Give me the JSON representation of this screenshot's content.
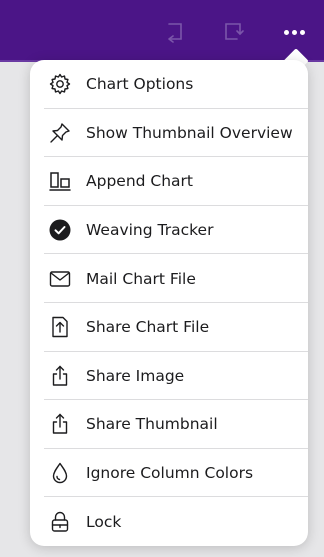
{
  "toolbar": {
    "background": "#4b1587",
    "icons": [
      "undo-icon",
      "redo-icon",
      "more-icon"
    ]
  },
  "menu": {
    "items": [
      {
        "label": "Chart Options",
        "icon": "gear-icon"
      },
      {
        "label": "Show Thumbnail Overview",
        "icon": "pin-icon"
      },
      {
        "label": "Append Chart",
        "icon": "append-chart-icon"
      },
      {
        "label": "Weaving Tracker",
        "icon": "checkmark-circle-icon"
      },
      {
        "label": "Mail Chart File",
        "icon": "envelope-icon"
      },
      {
        "label": "Share Chart File",
        "icon": "share-file-icon"
      },
      {
        "label": "Share Image",
        "icon": "share-icon"
      },
      {
        "label": "Share Thumbnail",
        "icon": "share-icon"
      },
      {
        "label": "Ignore Column Colors",
        "icon": "drop-icon"
      },
      {
        "label": "Lock",
        "icon": "lock-icon"
      }
    ]
  }
}
